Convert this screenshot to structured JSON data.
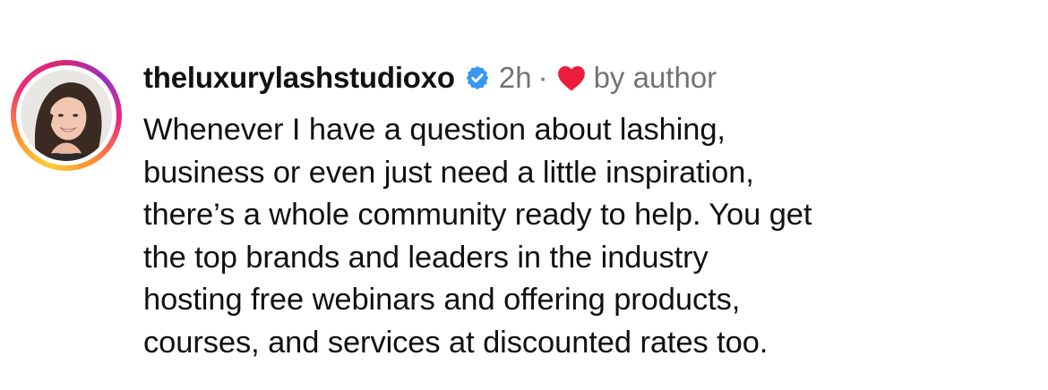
{
  "comment": {
    "username": "theluxurylashstudioxo",
    "verified_icon": "verified-badge-icon",
    "timestamp": "2h",
    "separator": "·",
    "liked_icon": "heart-icon",
    "liked_label": "by author",
    "colors": {
      "verified": "#3897f0",
      "heart": "#ed1c3a",
      "meta_text": "#737373"
    },
    "text_lines": [
      "Whenever I have a question about lashing,",
      "business or even just need a little inspiration,",
      "there’s a whole community ready to help. You get",
      "the top brands and leaders in the industry",
      "hosting free webinars and offering products,",
      "courses, and services at discounted rates too."
    ]
  }
}
